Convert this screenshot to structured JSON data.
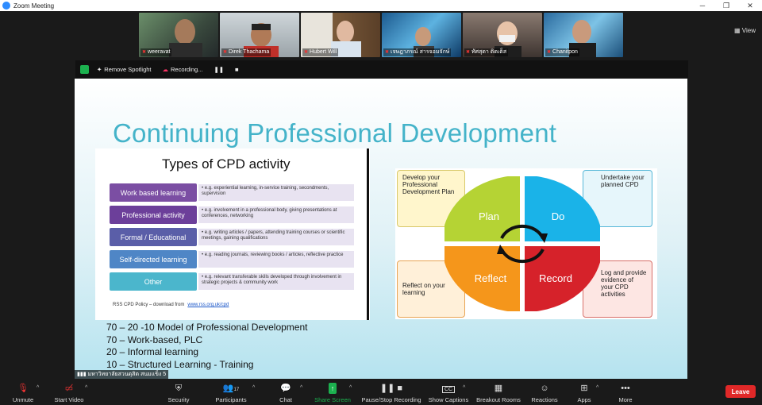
{
  "window": {
    "title": "Zoom Meeting"
  },
  "gallery": {
    "view_label": "View",
    "participants": [
      {
        "name": "weeravat"
      },
      {
        "name": "Direk Thachama"
      },
      {
        "name": "Hubert Will"
      },
      {
        "name": "เจษฎาภรณ์ สารจอมจักษ์"
      },
      {
        "name": "ทัศสุดา ติดเต็ส"
      },
      {
        "name": "Chanitpon"
      }
    ]
  },
  "spotlight_bar": {
    "remove_spotlight": "Remove Spotlight",
    "recording": "Recording..."
  },
  "slide": {
    "title": "Continuing Professional Development",
    "cpd_types": {
      "heading": "Types of CPD activity",
      "rows": [
        {
          "label": "Work based learning",
          "desc": "• e.g. experiential learning, in-service training, secondments, supervision",
          "color": "#7b4ea3"
        },
        {
          "label": "Professional activity",
          "desc": "• e.g. involvement in a professional body, giving presentations at conferences, networking",
          "color": "#6c3f9a"
        },
        {
          "label": "Formal / Educational",
          "desc": "• e.g. writing articles / papers, attending training courses or scientific meetings, gaining qualifications",
          "color": "#5a5ea8"
        },
        {
          "label": "Self-directed learning",
          "desc": "• e.g. reading journals, reviewing books / articles, reflective practice",
          "color": "#4f86c6"
        },
        {
          "label": "Other",
          "desc": "• e.g. relevant transferable skills developed through involvement in strategic projects & community work",
          "color": "#4bb6cc"
        }
      ],
      "footer": "RSS CPD Policy – download from",
      "footer_link": "www.rss.org.uk/cpd"
    },
    "cycle": {
      "quadrants": [
        "Plan",
        "Do",
        "Reflect",
        "Record"
      ],
      "boxes": {
        "plan": "Develop your Professional Development Plan",
        "do": "Undertake your planned CPD",
        "reflect": "Reflect on your learning",
        "record": "Log and provide evidence of your CPD activities"
      }
    },
    "model_lines": [
      "70 – 20 -10 Model of Professional Development",
      "70 – Work-based, PLC",
      "20 – Informal learning",
      "10 – Structured Learning  - Training"
    ]
  },
  "active_speaker": "มหาวิทยาลัยสวนดุสิต สนมแข็ง 5",
  "toolbar": {
    "unmute": "Unmute",
    "start_video": "Start Video",
    "security": "Security",
    "participants": "Participants",
    "participants_count": "17",
    "chat": "Chat",
    "share_screen": "Share Screen",
    "pause_recording": "Pause/Stop Recording",
    "show_captions": "Show Captions",
    "cc": "CC",
    "breakout_rooms": "Breakout Rooms",
    "reactions": "Reactions",
    "apps": "Apps",
    "more": "More",
    "leave": "Leave"
  },
  "colors": {
    "accent_green": "#1cb14f",
    "leave_red": "#e02828",
    "plan": "#b5d334",
    "do": "#1ab3e8",
    "reflect": "#f5961b",
    "record": "#d6222a"
  }
}
